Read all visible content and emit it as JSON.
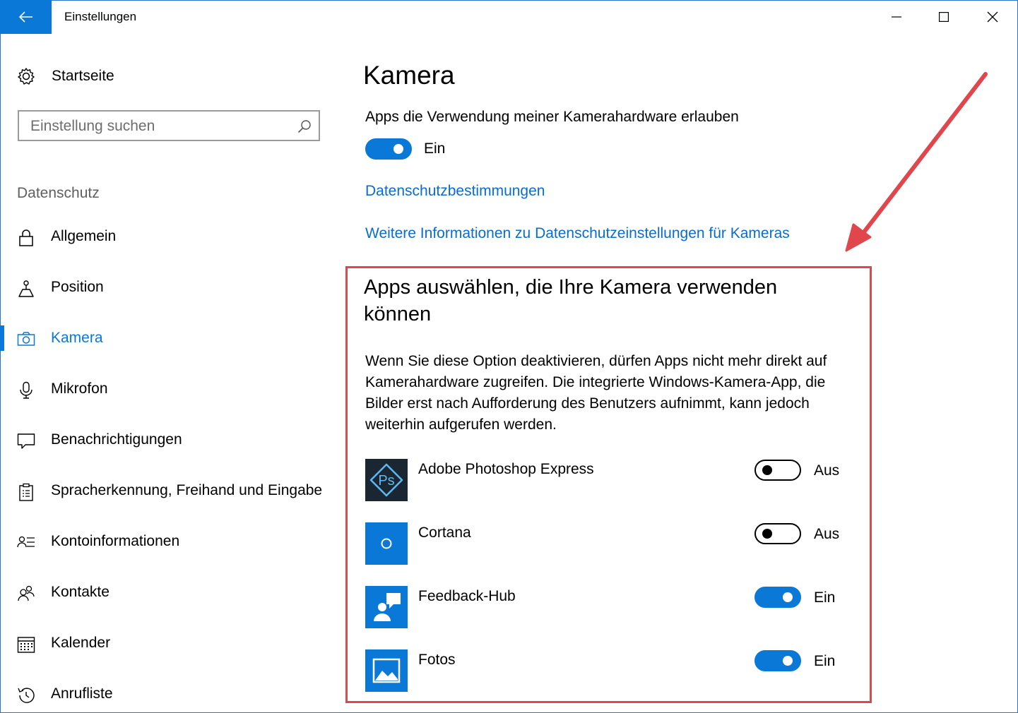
{
  "window": {
    "title": "Einstellungen",
    "accent": "#0a78d7"
  },
  "sidebar": {
    "home_label": "Startseite",
    "search_placeholder": "Einstellung suchen",
    "section": "Datenschutz",
    "items": [
      {
        "label": "Allgemein",
        "icon": "lock-icon",
        "active": false
      },
      {
        "label": "Position",
        "icon": "location-icon",
        "active": false
      },
      {
        "label": "Kamera",
        "icon": "camera-icon",
        "active": true
      },
      {
        "label": "Mikrofon",
        "icon": "microphone-icon",
        "active": false
      },
      {
        "label": "Benachrichtigungen",
        "icon": "notification-icon",
        "active": false
      },
      {
        "label": "Spracherkennung, Freihand und Eingabe",
        "icon": "clipboard-icon",
        "active": false
      },
      {
        "label": "Kontoinformationen",
        "icon": "account-info-icon",
        "active": false
      },
      {
        "label": "Kontakte",
        "icon": "contacts-icon",
        "active": false
      },
      {
        "label": "Kalender",
        "icon": "calendar-icon",
        "active": false
      },
      {
        "label": "Anrufliste",
        "icon": "call-history-icon",
        "active": false
      }
    ]
  },
  "main": {
    "title": "Kamera",
    "permission_label": "Apps die Verwendung meiner Kamerahardware erlauben",
    "permission_state": "Ein",
    "privacy_link": "Datenschutzbestimmungen",
    "info_link": "Weitere Informationen zu Datenschutzeinstellungen für Kameras",
    "apps_heading": "Apps auswählen, die Ihre Kamera verwenden können",
    "apps_description": "Wenn Sie diese Option deaktivieren, dürfen Apps nicht mehr direkt auf Kamerahardware zugreifen. Die integrierte Windows-Kamera-App, die Bilder erst nach Aufforderung des Benutzers aufnimmt, kann jedoch weiterhin aufgerufen werden.",
    "apps": [
      {
        "name": "Adobe Photoshop Express",
        "state": "Aus",
        "on": false,
        "icon": "photoshop-express-icon"
      },
      {
        "name": "Cortana",
        "state": "Aus",
        "on": false,
        "icon": "cortana-icon"
      },
      {
        "name": "Feedback-Hub",
        "state": "Ein",
        "on": true,
        "icon": "feedback-hub-icon"
      },
      {
        "name": "Fotos",
        "state": "Ein",
        "on": true,
        "icon": "photos-icon"
      }
    ]
  },
  "annotation": {
    "highlight_color": "#e0474c"
  }
}
